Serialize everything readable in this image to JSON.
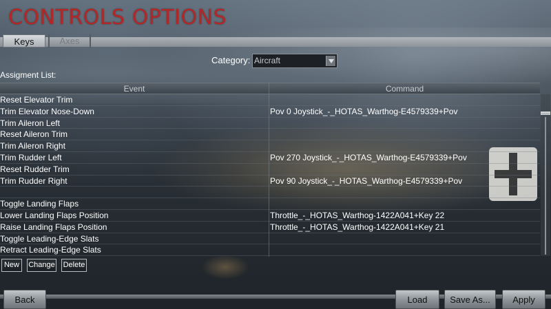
{
  "title": "CONTROLS OPTIONS",
  "tabs": [
    {
      "label": "Keys",
      "active": true
    },
    {
      "label": "Axes",
      "active": false
    }
  ],
  "category": {
    "label": "Category:",
    "selected": "Aircraft"
  },
  "assignment_list_label": "Assigment List:",
  "table": {
    "columns": [
      "Event",
      "Command"
    ],
    "rows": [
      {
        "event": "Reset Elevator Trim",
        "command": ""
      },
      {
        "event": "Trim Elevator Nose-Down",
        "command": "Pov 0 Joystick_-_HOTAS_Warthog-E4579339+Pov"
      },
      {
        "event": "Trim Aileron Left",
        "command": ""
      },
      {
        "event": "Reset Aileron Trim",
        "command": ""
      },
      {
        "event": "Trim Aileron Right",
        "command": ""
      },
      {
        "event": "Trim Rudder Left",
        "command": "Pov 270 Joystick_-_HOTAS_Warthog-E4579339+Pov"
      },
      {
        "event": "Reset Rudder Trim",
        "command": ""
      },
      {
        "event": "Trim Rudder Right",
        "command": "Pov 90 Joystick_-_HOTAS_Warthog-E4579339+Pov"
      },
      {
        "event": "",
        "command": ""
      },
      {
        "event": "Toggle Landing Flaps",
        "command": ""
      },
      {
        "event": "Lower Landing Flaps Position",
        "command": "Throttle_-_HOTAS_Warthog-1422A041+Key 22"
      },
      {
        "event": "Raise Landing Flaps Position",
        "command": "Throttle_-_HOTAS_Warthog-1422A041+Key 21"
      },
      {
        "event": "Toggle Leading-Edge Slats",
        "command": ""
      },
      {
        "event": "Retract Leading-Edge Slats",
        "command": ""
      }
    ]
  },
  "list_buttons": {
    "new": "New",
    "change": "Change",
    "delete": "Delete"
  },
  "footer_buttons": {
    "back": "Back",
    "load": "Load",
    "save_as": "Save As...",
    "apply": "Apply"
  },
  "colors": {
    "title": "#b02828",
    "text": "#ffffff"
  }
}
